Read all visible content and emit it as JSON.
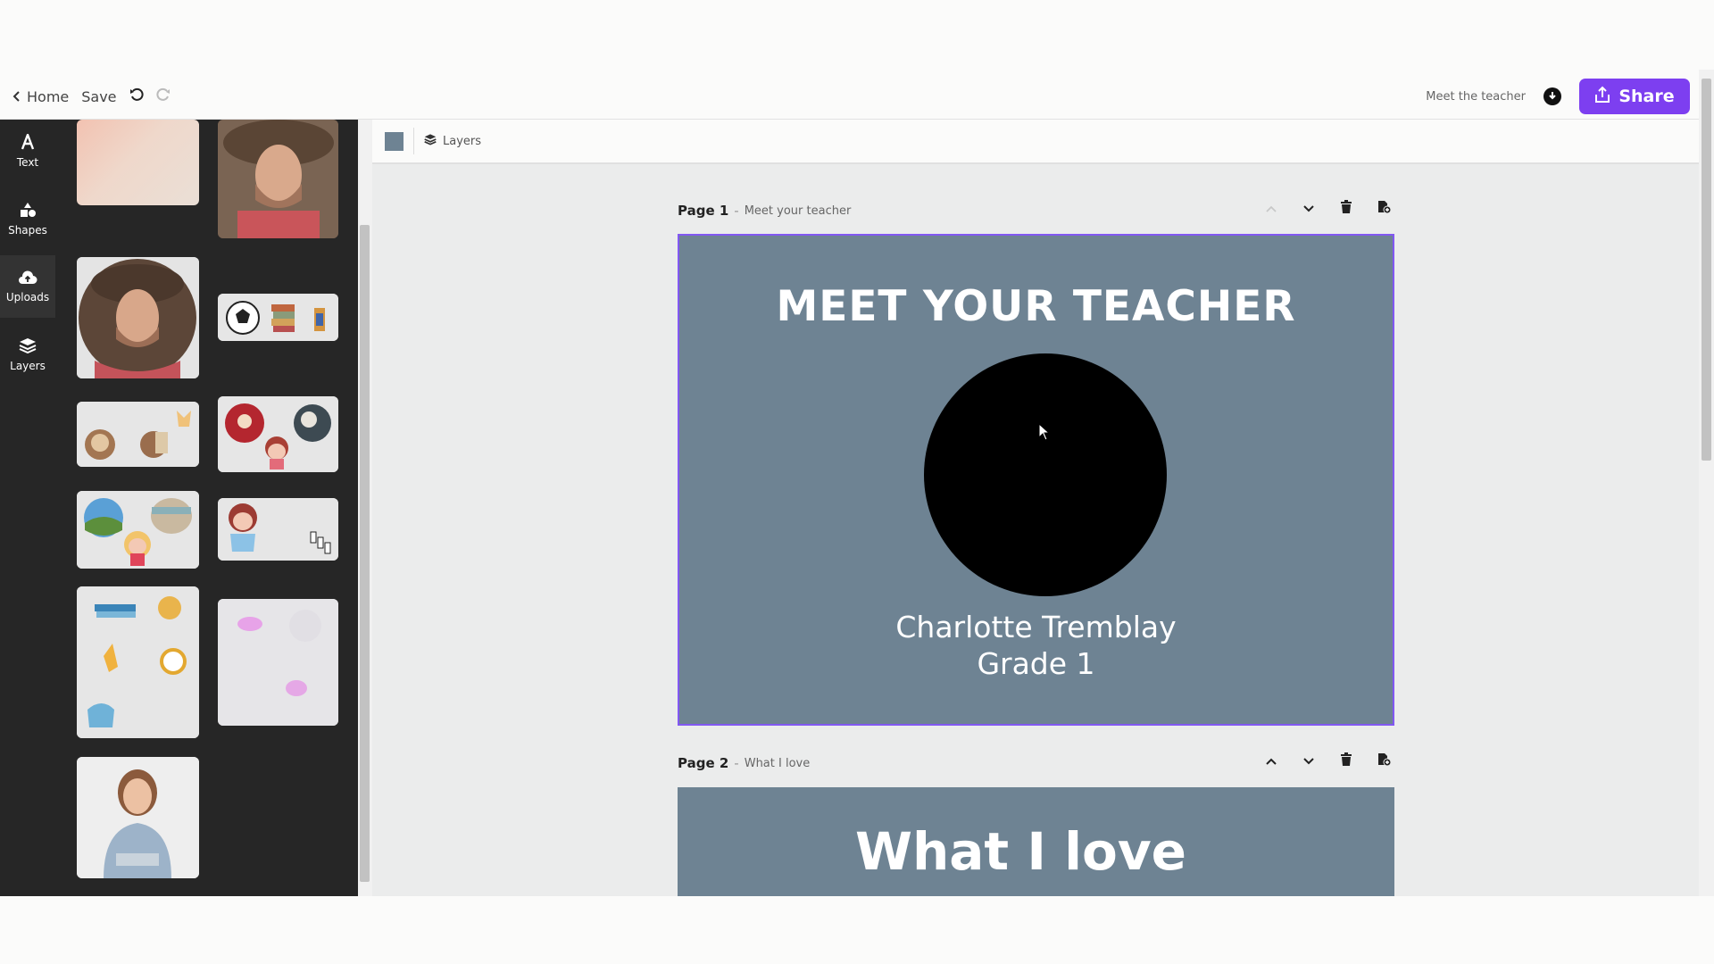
{
  "toolbar": {
    "home_label": "Home",
    "save_label": "Save",
    "document_name": "Meet the teacher",
    "share_label": "Share"
  },
  "rail": {
    "items": [
      {
        "label": "Text",
        "icon": "text-icon"
      },
      {
        "label": "Shapes",
        "icon": "shapes-icon"
      },
      {
        "label": "Uploads",
        "icon": "cloud-upload-icon"
      },
      {
        "label": "Layers",
        "icon": "layers-icon"
      }
    ]
  },
  "subbar": {
    "layers_label": "Layers",
    "background_color": "#6e8393"
  },
  "pages": [
    {
      "number": "Page 1",
      "subtitle": "Meet your teacher",
      "title": "MEET YOUR TEACHER",
      "name": "Charlotte Tremblay",
      "grade": "Grade 1"
    },
    {
      "number": "Page 2",
      "subtitle": "What I love",
      "title": "What I love"
    }
  ],
  "colors": {
    "accent": "#7d3ff0",
    "panel": "#262626",
    "page_bg": "#6e8393"
  }
}
